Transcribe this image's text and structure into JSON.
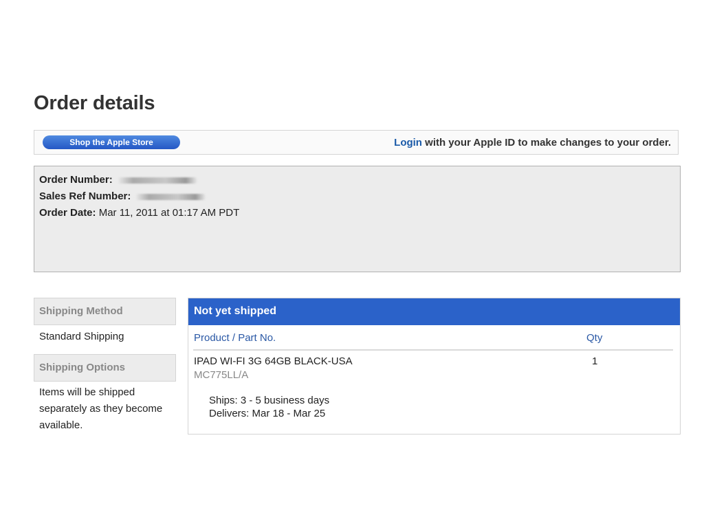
{
  "page": {
    "title": "Order details"
  },
  "toolbar": {
    "shop_button_label": "Shop the Apple Store",
    "login_link": "Login",
    "login_suffix": " with your Apple ID to make changes to your order."
  },
  "order_info": {
    "order_number_label": "Order Number:",
    "sales_ref_label": "Sales Ref Number:",
    "order_date_label": "Order Date:",
    "order_date_value": " Mar 11, 2011 at 01:17 AM PDT"
  },
  "sidebar": {
    "shipping_method_heading": "Shipping Method",
    "shipping_method_value": "Standard Shipping",
    "shipping_options_heading": "Shipping Options",
    "shipping_options_value": "Items will be shipped separately as they become available."
  },
  "shipment": {
    "status": "Not yet shipped",
    "columns": {
      "product": "Product / Part No.",
      "qty": "Qty"
    },
    "item": {
      "name": "IPAD WI-FI 3G 64GB BLACK-USA",
      "part_no": "MC775LL/A",
      "qty": "1",
      "ships": "Ships: 3 - 5 business days",
      "delivers": "Delivers: Mar 18 - Mar 25"
    }
  },
  "colors": {
    "accent_blue": "#2b62c9",
    "link_blue": "#1a5aa8"
  }
}
